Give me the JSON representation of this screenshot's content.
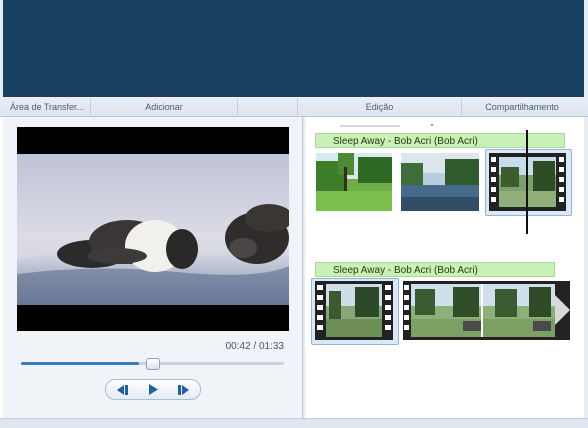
{
  "ribbon": {
    "groups": [
      {
        "label": "Área de Transfer..."
      },
      {
        "label": "Adicionar"
      },
      {
        "label": "Edição"
      },
      {
        "label": "Compartilhamento"
      }
    ]
  },
  "preview": {
    "time_display": "00:42 / 01:33",
    "progress": 0.45
  },
  "controls": {
    "prev_icon": "previous-frame-icon",
    "play_icon": "play-icon",
    "next_icon": "next-frame-icon"
  },
  "storyboard": {
    "rows": [
      {
        "audio_title": "Sleep Away - Bob Acri (Bob Acri)",
        "clips": [
          "grass-park",
          "lake-trees",
          "park-video"
        ]
      },
      {
        "audio_title": "Sleep Away - Bob Acri (Bob Acri)",
        "clips": [
          "park-video",
          "park-bench"
        ]
      }
    ]
  },
  "colors": {
    "header": "#173f5f",
    "audio_bar": "#c9f0b5",
    "accent": "#3a7cc4"
  }
}
